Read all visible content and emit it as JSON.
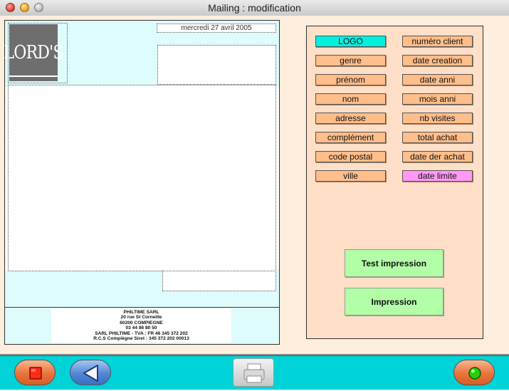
{
  "window": {
    "title": "Mailing : modification"
  },
  "document": {
    "logo_text": "LORD'S",
    "date": "mercredi 27 avril 2005",
    "footer": [
      "PHILTIME SARL",
      "20 rue St Corneille",
      "60200 COMPIEGNE",
      "03 44 86 80 50",
      "SARL PHILTIME - TVA : FR 46 345 372 202",
      "R.C.S Compiègne Siret : 345 372 202 00013"
    ]
  },
  "fields": {
    "left": [
      "LOGO",
      "genre",
      "prénom",
      "nom",
      "adresse",
      "complément",
      "code postal",
      "ville"
    ],
    "right": [
      "numéro client",
      "date creation",
      "date anni",
      "mois anni",
      "nb visites",
      "total achat",
      "date der achat",
      "date limite"
    ]
  },
  "actions": {
    "test_print": "Test impression",
    "print": "Impression"
  },
  "colors": {
    "field": "#ffbe8a",
    "field_active": "#00f0e0",
    "field_highlight": "#ff99f5",
    "panel": "#ffdfc7",
    "green_button": "#b2ffa8",
    "toolbar": "#00d3d7"
  },
  "toolbar": {
    "stop_icon": "stop-icon",
    "back_icon": "back-arrow-icon",
    "print_icon": "printer-icon",
    "go_icon": "green-light-icon"
  }
}
